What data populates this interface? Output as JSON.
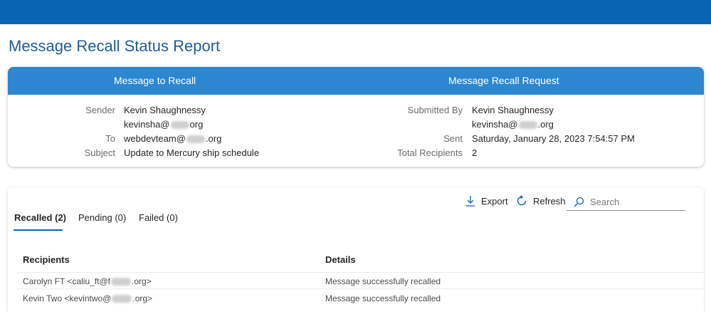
{
  "page": {
    "title": "Message Recall Status Report"
  },
  "summary": {
    "left_header": "Message to Recall",
    "right_header": "Message Recall Request",
    "sender_label": "Sender",
    "sender_name": "Kevin Shaughnessy",
    "sender_email_prefix": "kevinsha@",
    "sender_email_suffix": "org",
    "to_label": "To",
    "to_email_prefix": "webdevteam@",
    "to_email_suffix": ".org",
    "subject_label": "Subject",
    "subject_value": "Update to Mercury ship schedule",
    "submitted_by_label": "Submitted By",
    "submitted_by_name": "Kevin Shaughnessy",
    "submitted_email_prefix": "kevinsha@",
    "submitted_email_suffix": ".org",
    "sent_label": "Sent",
    "sent_value": "Saturday, January 28, 2023 7:54:57 PM",
    "total_label": "Total Recipients",
    "total_value": "2"
  },
  "toolbar": {
    "export_label": "Export",
    "refresh_label": "Refresh",
    "search_placeholder": "Search"
  },
  "tabs": [
    {
      "label": "Recalled (2)",
      "active": true
    },
    {
      "label": "Pending (0)",
      "active": false
    },
    {
      "label": "Failed (0)",
      "active": false
    }
  ],
  "table": {
    "headers": [
      "Recipients",
      "Details"
    ],
    "rows": [
      {
        "recipient_prefix": "Carolyn FT <caliu_ft@f",
        "recipient_suffix": ".org>",
        "details": "Message successfully recalled"
      },
      {
        "recipient_prefix": "Kevin Two <kevintwo@",
        "recipient_suffix": ".org>",
        "details": "Message successfully recalled"
      }
    ]
  },
  "colors": {
    "topbar": "#0a64b4",
    "card_header": "#2c86d0",
    "title": "#1f5c99"
  }
}
